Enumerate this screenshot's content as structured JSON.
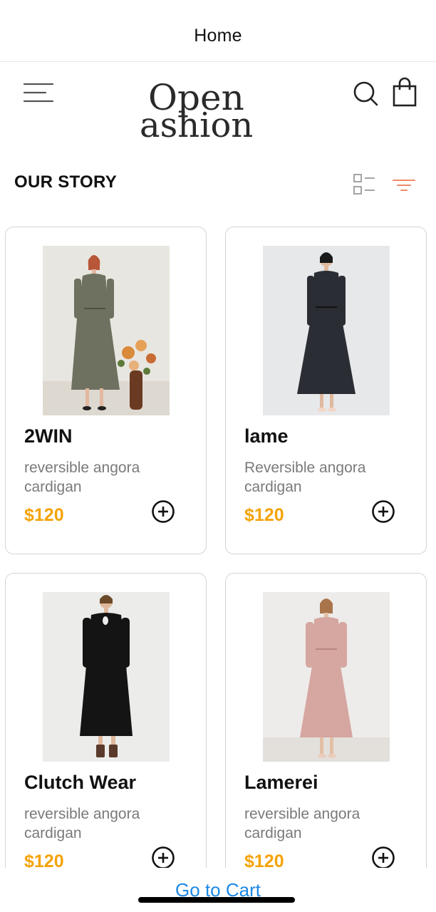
{
  "navbar": {
    "title": "Home"
  },
  "header": {
    "logo_line1": "Open",
    "logo_line2": "ashion",
    "icons": {
      "menu": "hamburger-menu-icon",
      "search": "search-icon",
      "bag": "shopping-bag-icon"
    }
  },
  "section": {
    "title": "OUR STORY",
    "icons": {
      "view": "list-view-icon",
      "filter": "filter-icon"
    }
  },
  "colors": {
    "price": "#f5a30a",
    "link": "#1e88e5",
    "filter": "#ef8a67",
    "card_border": "#d4d4d4"
  },
  "products": [
    {
      "name": "2WIN",
      "description": "reversible angora cardigan",
      "price": "$120",
      "dress_color": "#6e7060"
    },
    {
      "name": "lame",
      "description": "Reversible angora cardigan",
      "price": "$120",
      "dress_color": "#2a2d33"
    },
    {
      "name": "Clutch Wear",
      "description": "reversible angora cardigan",
      "price": "$120",
      "dress_color": "#141414"
    },
    {
      "name": "Lamerei",
      "description": "reversible angora cardigan",
      "price": "$120",
      "dress_color": "#d6a6a0"
    }
  ],
  "footer": {
    "cart_link": "Go to Cart"
  }
}
